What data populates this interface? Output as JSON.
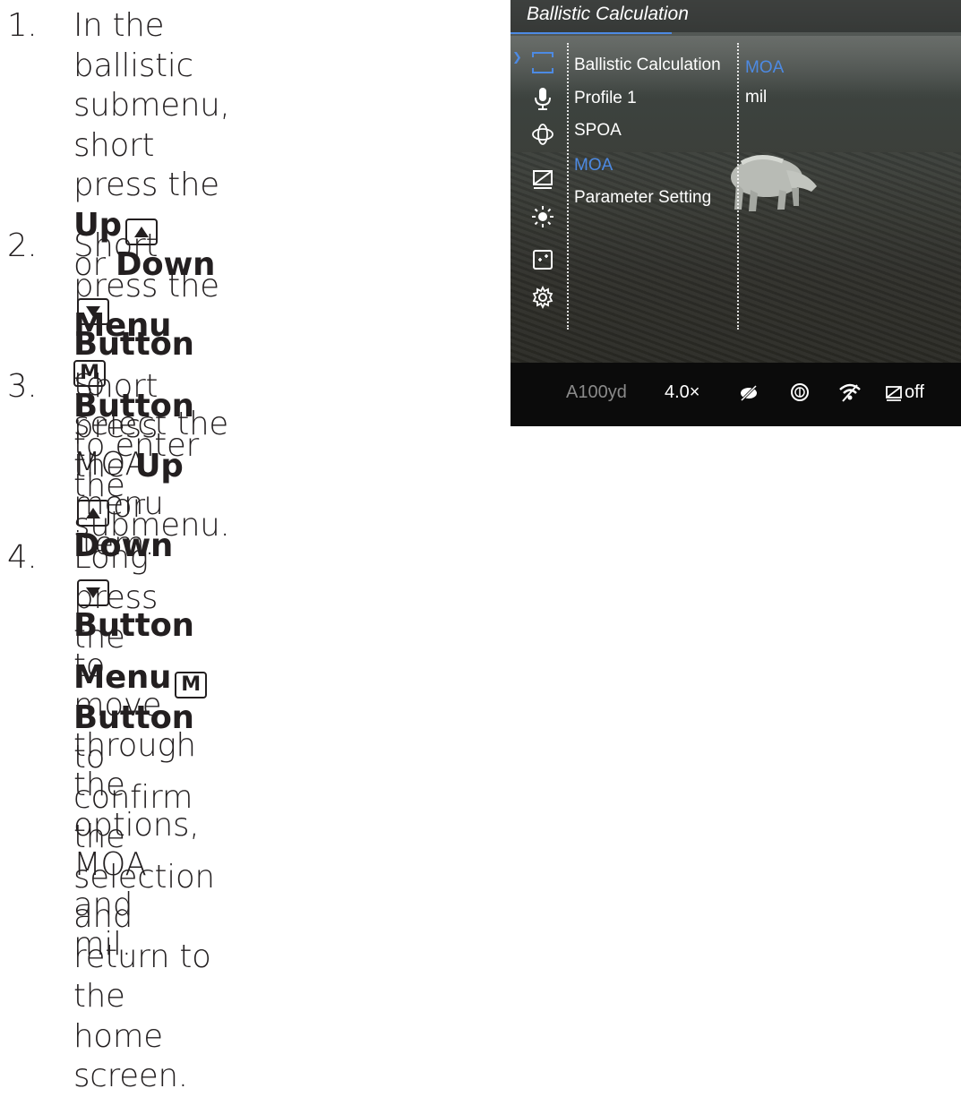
{
  "steps": [
    {
      "num": "1.",
      "line1": "In the ballistic submenu,",
      "short_press": "short press the",
      "up": "Up",
      "or": "or",
      "down": "Down",
      "button": "Button",
      "to": "to",
      "line4": "select the MOA menu",
      "line5": "item."
    },
    {
      "num": "2.",
      "short_press": "Short press the",
      "menu": "Menu",
      "button": "Button",
      "to_enter": "to enter the",
      "line3": "submenu."
    },
    {
      "num": "3.",
      "short_press": "Short press the",
      "up": "Up",
      "or": "or",
      "down": "Down",
      "button": "Button",
      "to_move": "to move",
      "line3": "through the options,",
      "line4": "MOA and mil."
    },
    {
      "num": "4.",
      "long_press": "Long press the",
      "menu": "Menu",
      "button": "Button",
      "to_confirm": "to confirm the selection",
      "line2": "and return to the home screen."
    }
  ],
  "key_m": "M",
  "screen": {
    "header_title": "Ballistic Calculation",
    "menu_items": [
      "Ballistic Calculation",
      "Profile 1",
      "SPOA",
      "MOA",
      "Parameter Setting"
    ],
    "active_menu_index": 3,
    "options": [
      "MOA",
      "mil"
    ],
    "active_option_index": 0,
    "icons": [
      "reticle-icon",
      "microphone-icon",
      "rotate-icon",
      "display-off-icon",
      "brightness-icon",
      "zoom-icon",
      "gear-icon"
    ],
    "status": {
      "range": "A100yd",
      "zoom": "4.0×",
      "pip_icon": "pip-off-icon",
      "compass_icon": "compass-icon",
      "wifi_icon": "wifi-off-icon",
      "display_icon": "display-off-icon",
      "display_value": "off"
    },
    "accent": "#4d8ae3"
  }
}
